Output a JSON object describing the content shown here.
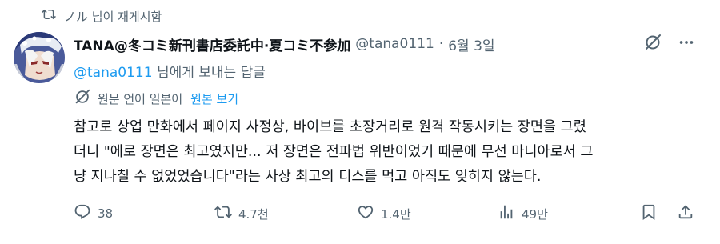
{
  "retweet": {
    "icon": "retweet-icon",
    "text": "ノル 님이 재게시함"
  },
  "author": {
    "display_name": "TANA@冬コミ新刊書店委託中·夏コミ不参加",
    "handle": "@tana0111",
    "separator": "·",
    "date": "6월 3일",
    "avatar_icon": "avatar-image"
  },
  "reply_to": {
    "mention": "@tana0111",
    "suffix": " 님에게 보내는 답글"
  },
  "translation": {
    "icon": "translate-icon",
    "label": "원문 언어 일본어",
    "show_original": "원본 보기"
  },
  "tweet": {
    "lines": [
      "참고로 상업 만화에서 페이지 사정상, 바이브를 초장거리로 원격 작동시키는 장면을 그렸",
      "더니 \"에로 장면은 최고였지만... 저 장면은 전파법 위반이었기 때문에 무선 마니아로서 그",
      "냥 지나칠 수 없었었습니다\"라는 사상 최고의 디스를 먹고 아직도 잊히지 않는다."
    ]
  },
  "actions": {
    "reply_count": "38",
    "retweet_count": "4.7천",
    "like_count": "1.4만",
    "views_count": "49만"
  },
  "colors": {
    "accent": "#1d9bf0",
    "muted": "#536471",
    "text": "#0f1419"
  }
}
